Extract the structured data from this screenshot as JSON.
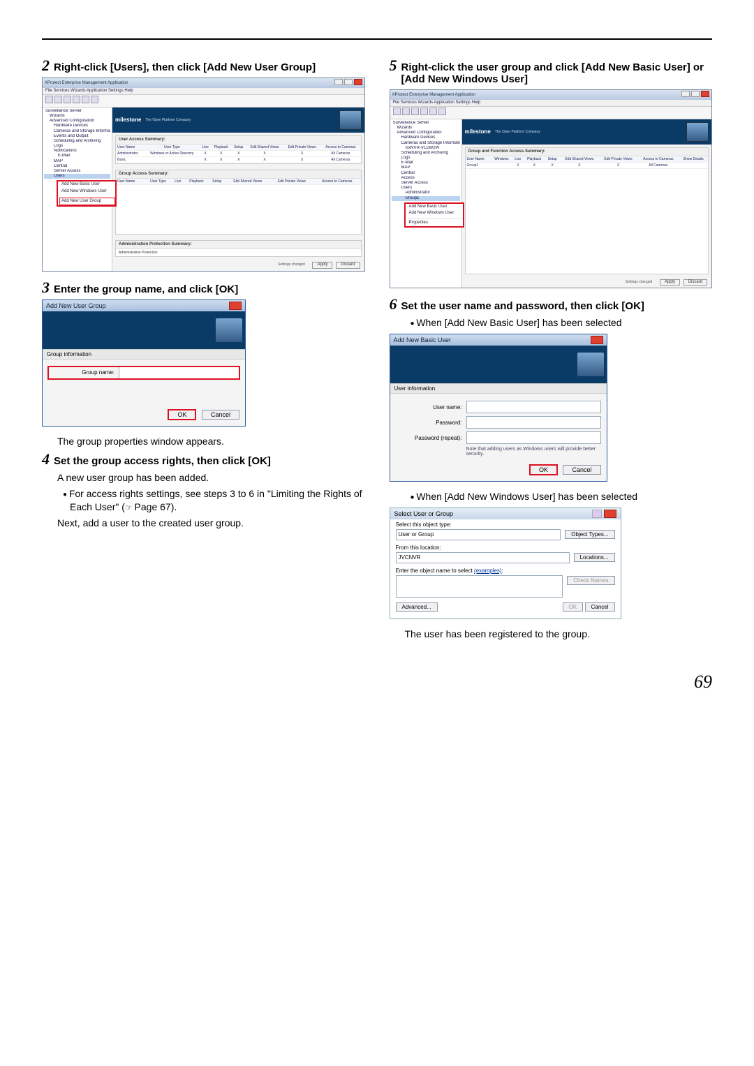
{
  "page_number": "69",
  "left": {
    "step2": {
      "num": "2",
      "title": "Right-click [Users], then click [Add New User Group]",
      "app": {
        "title": "XProtect Enterprise Management Application",
        "menu": "File   Services   Wizards   Application Settings   Help",
        "tree": [
          "Surveillance Server",
          "Wizards",
          "Advanced Configuration",
          "Hardware Devices",
          "Cameras and Storage Information",
          "Events and Output",
          "Scheduling and Archiving",
          "Logs",
          "Notifications",
          "E-Mail",
          "MAP",
          "Central",
          "Server Access"
        ],
        "tree_users": "Users",
        "context": {
          "i1": "Add New Basic User",
          "i2": "Add New Windows User",
          "i3": "Add New User Group"
        },
        "brand": "milestone",
        "brand_tag": "The Open Platform Company",
        "panel1_title": "User Access Summary:",
        "cols": [
          "User Name",
          "User Type",
          "Live",
          "Playback",
          "Setup",
          "Edit Shared Views",
          "Edit Private Views",
          "Access to Cameras"
        ],
        "row_admin": [
          "Administrator",
          "Windows or Active Directory",
          "X",
          "X",
          "X",
          "X",
          "X",
          "All Cameras"
        ],
        "row_basic": [
          "Basic",
          "",
          "X",
          "X",
          "X",
          "X",
          "X",
          "All Cameras"
        ],
        "panel2_title": "Group Access Summary:",
        "panel3_title": "Administration Protection Summary:",
        "panel3_sub": "Administration Protection",
        "btn_changes": "Settings changed",
        "btn_apply": "Apply",
        "btn_discard": "Discard"
      }
    },
    "step3": {
      "num": "3",
      "title": "Enter the group name, and click [OK]",
      "dlg": {
        "title": "Add New User Group",
        "section": "Group information",
        "label": "Group name:",
        "ok": "OK",
        "cancel": "Cancel"
      },
      "after": "The group properties window appears."
    },
    "step4": {
      "num": "4",
      "title": "Set the group access rights, then click [OK]",
      "line1": "A new user group has been added.",
      "bullet": "For access rights settings, see steps 3 to 6 in \"Limiting the Rights of Each User\" (",
      "bullet_ref": " Page 67).",
      "line2": "Next, add a user to the created user group."
    }
  },
  "right": {
    "step5": {
      "num": "5",
      "title": "Right-click the user group and click [Add New Basic User] or [Add New Windows User]",
      "app": {
        "title": "XProtect Enterprise Management Application",
        "menu": "File   Services   Wizards   Application Settings   Help",
        "tree": [
          "Surveillance Server",
          "Wizards",
          "Advanced Configuration",
          "Hardware Devices",
          "Cameras and Storage Information",
          "IsxNVR-VC2W2W",
          "Scheduling and Archiving",
          "Logs",
          "E-Mail",
          "MAP",
          "Central",
          "Access",
          "Server Access",
          "Users",
          "Administrator"
        ],
        "tree_sel": "Group1",
        "ctx_i1": "Add New Basic User",
        "ctx_i2": "Add New Windows User",
        "ctx_sub": "Properties",
        "brand": "milestone",
        "brand_tag": "The Open Platform Company",
        "panel_title": "Group and Function Access Summary:",
        "cols": [
          "User Name",
          "Windows",
          "Live",
          "Playback",
          "Setup",
          "Edit Shared Views",
          "Edit Private Views",
          "Access to Cameras"
        ],
        "row": [
          "Group1",
          "",
          "X",
          "X",
          "X",
          "X",
          "X",
          "All Cameras"
        ],
        "show_details": "Show Details",
        "btn_changes": "Settings changed",
        "btn_apply": "Apply",
        "btn_discard": "Discard"
      }
    },
    "step6": {
      "num": "6",
      "title": "Set the user name and password, then click [OK]",
      "bullet_a": "When [Add New Basic User] has been selected",
      "dlg_a": {
        "title": "Add New Basic User",
        "section": "User information",
        "l_user": "User name:",
        "l_pass": "Password:",
        "l_pass2": "Password (repeat):",
        "note": "Note that adding users as Windows users will provide better security.",
        "ok": "OK",
        "cancel": "Cancel"
      },
      "bullet_b": "When [Add New Windows User] has been selected",
      "dlg_b": {
        "title": "Select User or Group",
        "l1": "Select this object type:",
        "v1": "User or Group",
        "b1": "Object Types...",
        "l2": "From this location:",
        "v2": "JVCNVR",
        "b2": "Locations...",
        "l3h": "Enter the object name to select",
        "l3l": "(examples)",
        "l3suffix": ":",
        "b3": "Check Names",
        "adv": "Advanced...",
        "ok": "OK",
        "cancel": "Cancel"
      },
      "after": "The user has been registered to the group."
    }
  }
}
